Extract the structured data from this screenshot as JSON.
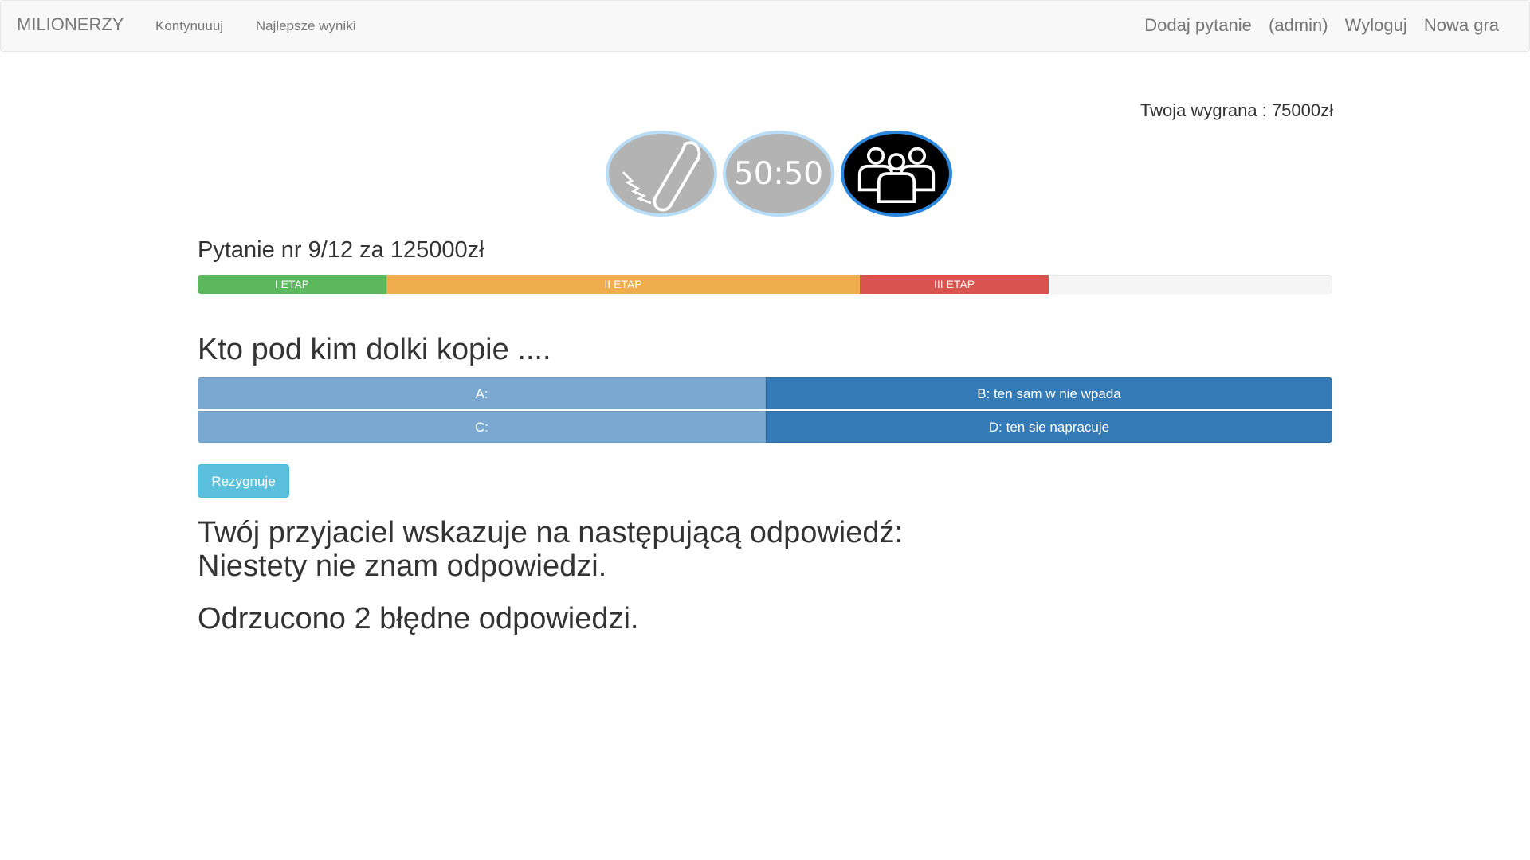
{
  "nav": {
    "brand": "MILIONERZY",
    "left": [
      "Kontynuuuj",
      "Najlepsze wyniki"
    ],
    "right": [
      "Dodaj pytanie",
      "(admin)",
      "Wyloguj",
      "Nowa gra"
    ]
  },
  "winnings": "Twoja wygrana : 75000zł",
  "lifelines": {
    "phone": "phone-a-friend-icon",
    "fifty": "50:50",
    "audience": "ask-the-audience-icon"
  },
  "question_number": "Pytanie nr 9/12 za 125000zł",
  "stages": [
    "I ETAP",
    "II ETAP",
    "III ETAP"
  ],
  "question": "Kto pod kim dolki kopie ....",
  "answers": {
    "a": "A:",
    "b": "B: ten sam w nie wpada",
    "c": "C:",
    "d": "D: ten sie napracuje"
  },
  "resign_label": "Rezygnuje",
  "friend_line1": "Twój przyjaciel wskazuje na następującą odpowiedź:",
  "friend_line2": "Niestety nie znam odpowiedzi.",
  "fifty_result": "Odrzucono 2 błędne odpowiedzi.",
  "colors": {
    "stage1": "#5cb85c",
    "stage2": "#f0ad4e",
    "stage3": "#d9534f",
    "answer_active": "#337ab7",
    "answer_removed": "#7aa8d1",
    "resign": "#5bc0de"
  }
}
